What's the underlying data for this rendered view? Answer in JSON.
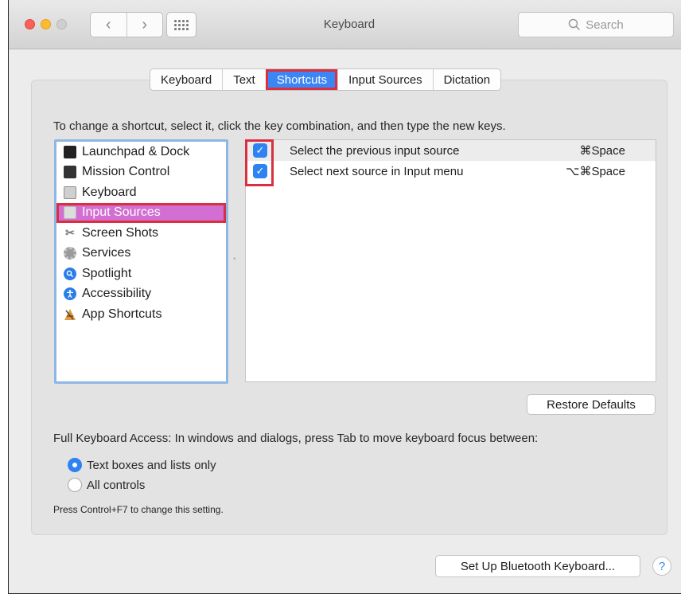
{
  "window": {
    "title": "Keyboard"
  },
  "toolbar": {
    "back_icon": "‹",
    "forward_icon": "›",
    "search_placeholder": "Search"
  },
  "tabs": [
    {
      "label": "Keyboard"
    },
    {
      "label": "Text"
    },
    {
      "label": "Shortcuts",
      "active": true
    },
    {
      "label": "Input Sources"
    },
    {
      "label": "Dictation"
    }
  ],
  "instruction": "To change a shortcut, select it, click the key combination, and then type the new keys.",
  "categories": [
    {
      "label": "Launchpad & Dock",
      "icon": "launchpad-icon"
    },
    {
      "label": "Mission Control",
      "icon": "mission-control-icon"
    },
    {
      "label": "Keyboard",
      "icon": "keyboard-icon"
    },
    {
      "label": "Input Sources",
      "icon": "input-sources-icon",
      "selected": true
    },
    {
      "label": "Screen Shots",
      "icon": "screenshot-icon"
    },
    {
      "label": "Services",
      "icon": "services-gear-icon"
    },
    {
      "label": "Spotlight",
      "icon": "spotlight-icon"
    },
    {
      "label": "Accessibility",
      "icon": "accessibility-icon"
    },
    {
      "label": "App Shortcuts",
      "icon": "app-shortcuts-icon"
    }
  ],
  "shortcuts": [
    {
      "label": "Select the previous input source",
      "keys": "⌘Space",
      "checked": true
    },
    {
      "label": "Select next source in Input menu",
      "keys": "⌥⌘Space",
      "checked": true
    }
  ],
  "restore_defaults": "Restore Defaults",
  "full_keyboard_access": {
    "label": "Full Keyboard Access: In windows and dialogs, press Tab to move keyboard focus between:",
    "options": [
      {
        "label": "Text boxes and lists only",
        "selected": true
      },
      {
        "label": "All controls",
        "selected": false
      }
    ],
    "hint": "Press Control+F7 to change this setting."
  },
  "bluetooth_button": "Set Up Bluetooth Keyboard...",
  "help_button": "?",
  "colors": {
    "accent": "#3b86f4",
    "selection": "#d36fd2",
    "highlight_border": "#d92f3f"
  }
}
